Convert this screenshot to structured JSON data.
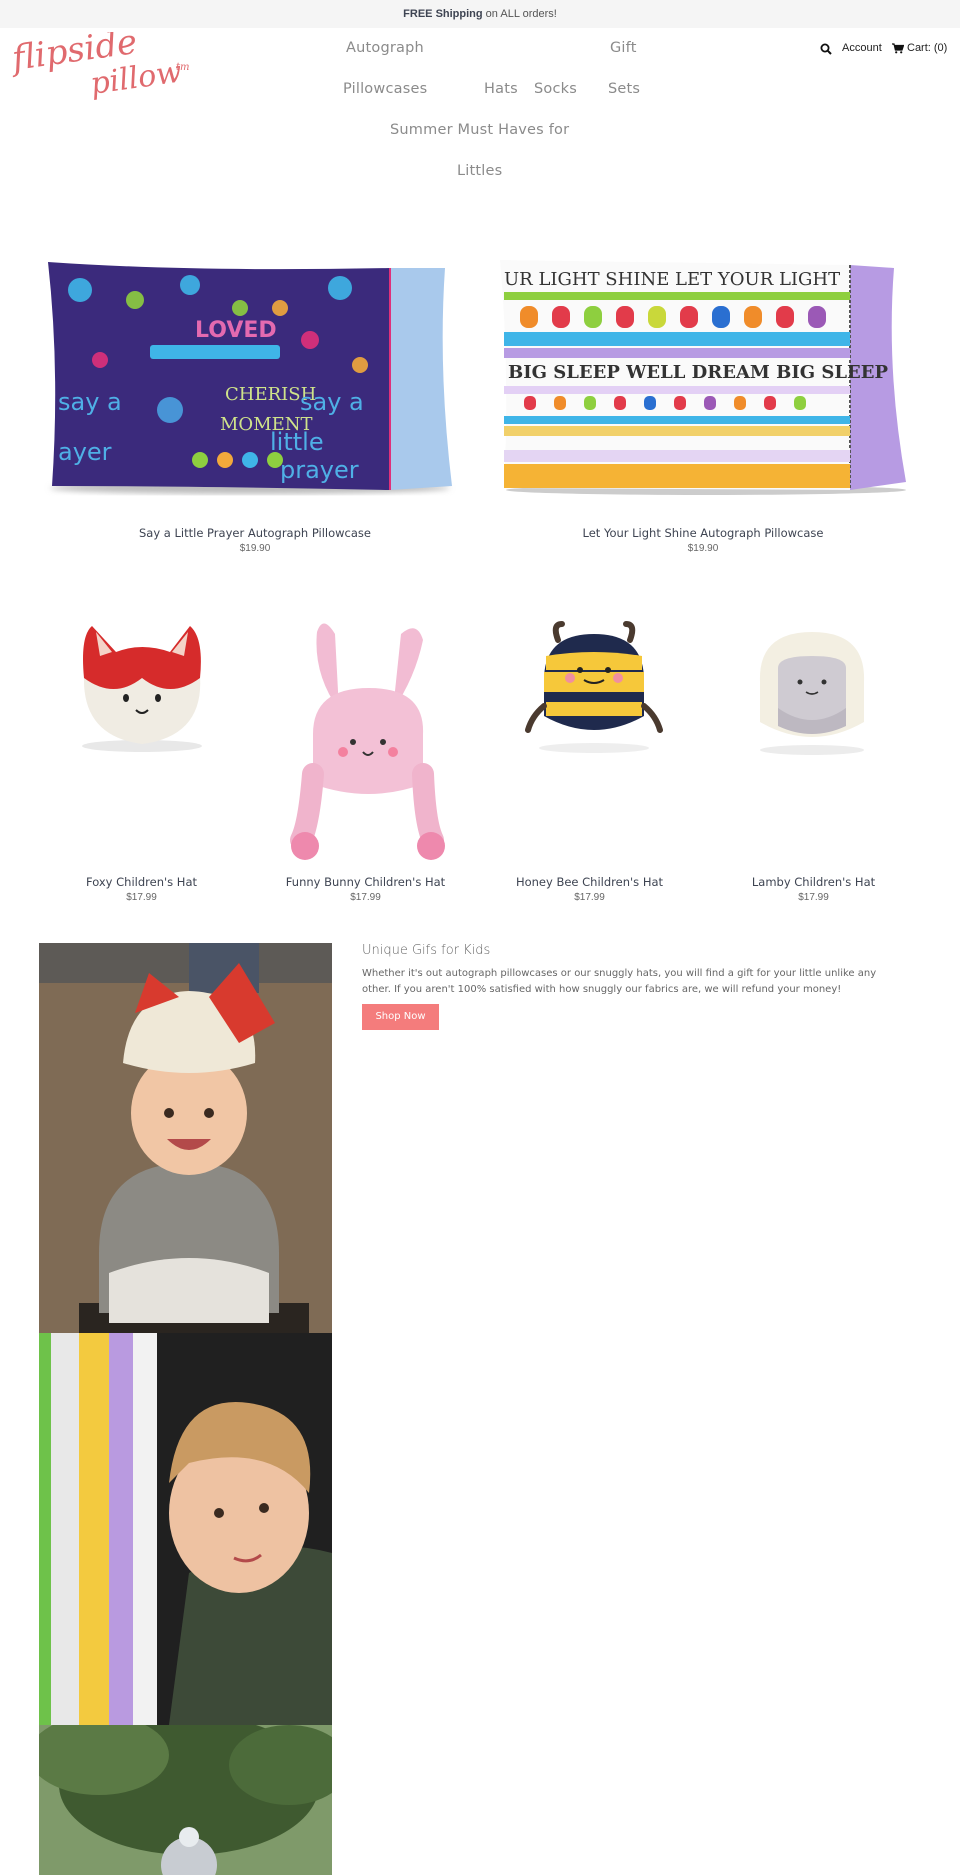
{
  "announcement": {
    "bold": "FREE Shipping",
    "rest": " on ALL orders!"
  },
  "brand": {
    "line1": "flipside",
    "line2": "pillow",
    "tm": "tm",
    "color": "#e06a6e"
  },
  "nav": {
    "autograph": "Autograph",
    "pillowcases": "Pillowcases",
    "hats": "Hats",
    "socks": "Socks",
    "gift": "Gift",
    "sets": "Sets",
    "summer1": "Summer Must Haves for",
    "summer2": "Littles"
  },
  "header": {
    "account": "Account",
    "cart": "Cart: (0)"
  },
  "pillowcases": [
    {
      "title": "Say a Little Prayer Autograph Pillowcase",
      "price": "$19.90"
    },
    {
      "title": "Let Your Light Shine Autograph Pillowcase",
      "price": "$19.90"
    }
  ],
  "hats": [
    {
      "title": "Foxy Children's Hat",
      "price": "$17.99"
    },
    {
      "title": "Funny Bunny Children's Hat",
      "price": "$17.99"
    },
    {
      "title": "Honey Bee Children's Hat",
      "price": "$17.99"
    },
    {
      "title": "Lamby Children's Hat",
      "price": "$17.99"
    }
  ],
  "promo": {
    "title": "Unique Gifs for Kids",
    "text": "Whether it's out autograph pillowcases or our snuggly hats, you will find a gift for your little unlike any other. If you aren't 100% satisfied with how snuggly our fabrics are, we will refund your money!",
    "button": "Shop Now"
  },
  "colors": {
    "accent": "#f47c7c",
    "title": "#3e4452",
    "nav": "#8b8b8b"
  }
}
